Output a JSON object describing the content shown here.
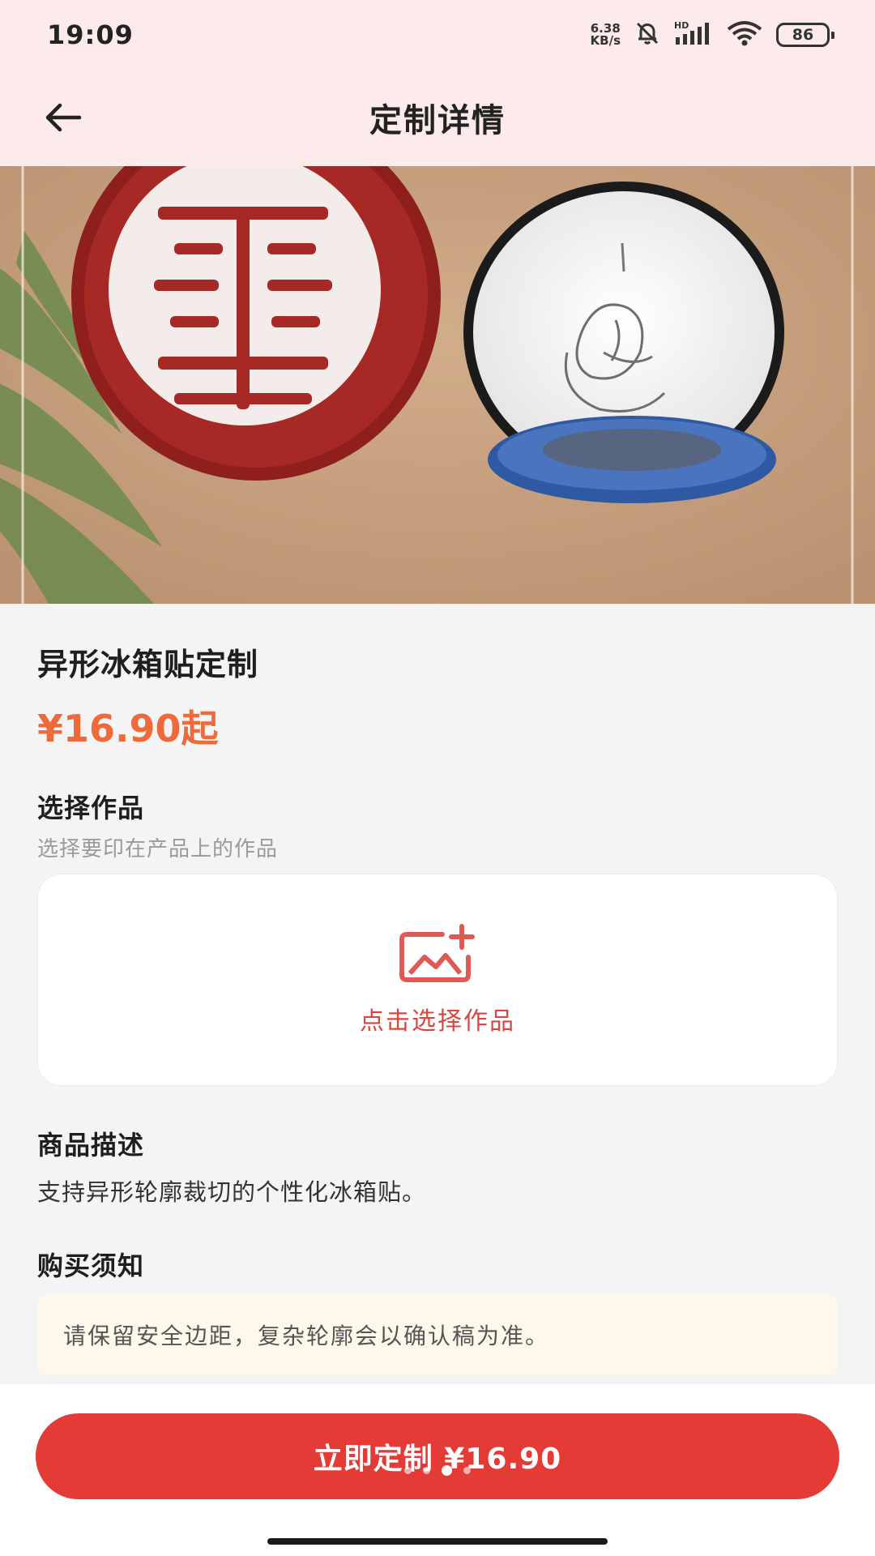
{
  "status_bar": {
    "time": "19:09",
    "net_speed_value": "6.38",
    "net_speed_unit": "KB/s",
    "network_label": "HD",
    "battery": "86",
    "icons": [
      "bell-muted-icon",
      "signal-icon",
      "wifi-icon",
      "battery-icon"
    ]
  },
  "nav": {
    "title": "定制详情",
    "back_icon": "arrow-left-icon"
  },
  "banner": {
    "page_count": 4,
    "active_index": 2
  },
  "product": {
    "title": "异形冰箱贴定制",
    "price": "¥16.90起"
  },
  "select_work": {
    "title": "选择作品",
    "subtitle": "选择要印在产品上的作品",
    "upload_label": "点击选择作品",
    "upload_icon": "image-add-icon"
  },
  "description": {
    "title": "商品描述",
    "text": "支持异形轮廓裁切的个性化冰箱贴。"
  },
  "purchase_notice": {
    "title": "购买须知",
    "text": "请保留安全边距，复杂轮廓会以确认稿为准。"
  },
  "bottom": {
    "button_label": "立即定制 ¥16.90"
  },
  "colors": {
    "accent_red": "#e43b36",
    "price_orange": "#ee6a3a",
    "header_pink": "#fcebea",
    "notice_bg": "#fdf8ea"
  }
}
